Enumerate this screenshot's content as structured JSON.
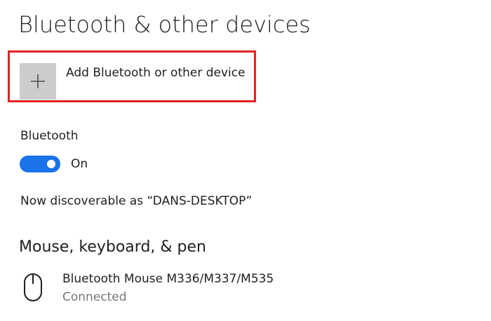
{
  "page": {
    "title": "Bluetooth & other devices"
  },
  "add_device": {
    "label": "Add Bluetooth or other device",
    "icon": "plus-icon",
    "highlight_color": "#e02424"
  },
  "bluetooth": {
    "label": "Bluetooth",
    "toggle_state": "On",
    "toggle_on": true,
    "toggle_color": "#1a73e8",
    "discoverable_text": "Now discoverable as “DANS-DESKTOP”"
  },
  "mouse_section": {
    "heading": "Mouse, keyboard, & pen",
    "devices": [
      {
        "name": "Bluetooth Mouse M336/M337/M535",
        "status": "Connected",
        "icon": "mouse-icon"
      }
    ]
  }
}
